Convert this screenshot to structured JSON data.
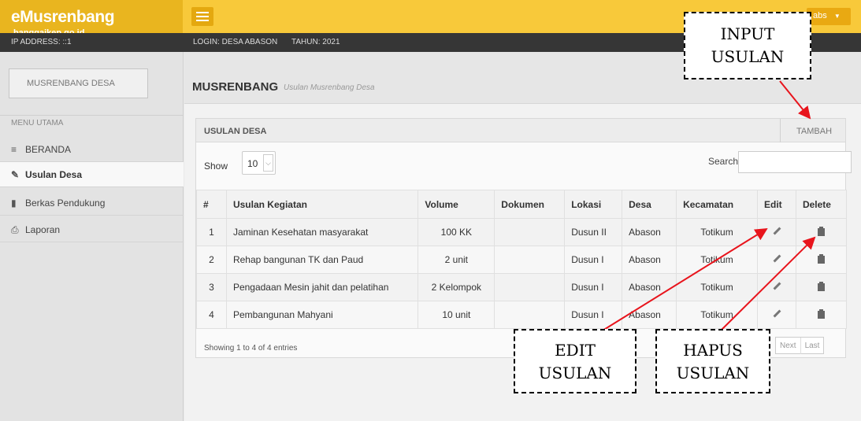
{
  "app": {
    "name": "eMusrenbang",
    "domain": "banggaikep.go.id"
  },
  "user_menu": {
    "label": "abs"
  },
  "info_bar": {
    "ip": "IP ADDRESS: ::1",
    "login": "LOGIN: DESA ABASON",
    "tahun": "TAHUN: 2021"
  },
  "sidebar": {
    "header_box": "MUSRENBANG DESA",
    "menu_title": "MENU UTAMA",
    "items": [
      {
        "label": "BERANDA",
        "icon": "list-icon",
        "active": false
      },
      {
        "label": "Usulan Desa",
        "icon": "edit-icon",
        "active": true
      },
      {
        "label": "Berkas Pendukung",
        "icon": "book-icon",
        "active": false
      },
      {
        "label": "Laporan",
        "icon": "print-icon",
        "active": false
      }
    ]
  },
  "page": {
    "title": "MUSRENBANG",
    "subtitle": "Usulan Musrenbang Desa"
  },
  "panel": {
    "title": "USULAN DESA",
    "add_button": "TAMBAH",
    "show_label": "Show",
    "show_value": "10",
    "search_label": "Search:",
    "search_value": ""
  },
  "table": {
    "columns": [
      "#",
      "Usulan Kegiatan",
      "Volume",
      "Dokumen",
      "Lokasi",
      "Desa",
      "Kecamatan",
      "Edit",
      "Delete"
    ],
    "rows": [
      {
        "no": "1",
        "kegiatan": "Jaminan Kesehatan masyarakat",
        "volume": "100 KK",
        "dokumen": "",
        "lokasi": "Dusun II",
        "desa": "Abason",
        "kecamatan": "Totikum"
      },
      {
        "no": "2",
        "kegiatan": "Rehap bangunan TK dan Paud",
        "volume": "2 unit",
        "dokumen": "",
        "lokasi": "Dusun I",
        "desa": "Abason",
        "kecamatan": "Totikum"
      },
      {
        "no": "3",
        "kegiatan": "Pengadaan Mesin jahit dan pelatihan",
        "volume": "2 Kelompok",
        "dokumen": "",
        "lokasi": "Dusun I",
        "desa": "Abason",
        "kecamatan": "Totikum"
      },
      {
        "no": "4",
        "kegiatan": "Pembangunan Mahyani",
        "volume": "10 unit",
        "dokumen": "",
        "lokasi": "Dusun I",
        "desa": "Abason",
        "kecamatan": "Totikum"
      }
    ],
    "footer_info": "Showing 1 to 4 of 4 entries",
    "pager": [
      "Next",
      "Last"
    ]
  },
  "annotations": {
    "input": [
      "INPUT",
      "USULAN"
    ],
    "edit": [
      "EDIT",
      "USULAN"
    ],
    "hapus": [
      "HAPUS",
      "USULAN"
    ],
    "arrow_color": "#e8141c"
  },
  "colors": {
    "topbar": "#f8c93a",
    "brand": "#e9b51f",
    "infobar": "#363636"
  }
}
